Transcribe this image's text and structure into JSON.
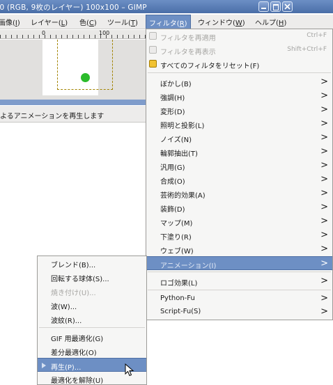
{
  "window": {
    "title": ".0 (RGB, 9枚のレイヤー) 100x100 – GIMP"
  },
  "menubar": {
    "items": [
      {
        "label": "画像(",
        "key": "I",
        "tail": ")"
      },
      {
        "label": "レイヤー(",
        "key": "L",
        "tail": ")"
      },
      {
        "label": "色(",
        "key": "C",
        "tail": ")"
      },
      {
        "label": "ツール(",
        "key": "T",
        "tail": ")"
      },
      {
        "label": "フィルタ(",
        "key": "R",
        "tail": ")"
      },
      {
        "label": "ウィンドウ(",
        "key": "W",
        "tail": ")"
      },
      {
        "label": "ヘルプ(",
        "key": "H",
        "tail": ")"
      }
    ]
  },
  "ruler": {
    "label_a": "0",
    "label_b": "100"
  },
  "status": {
    "text": "よるアニメーションを再生します"
  },
  "filters_menu": {
    "top": [
      {
        "label": "フィルタを再適用",
        "accel": "Ctrl+F",
        "disabled": true
      },
      {
        "label": "フィルタを再表示",
        "accel": "Shift+Ctrl+F",
        "disabled": true
      },
      {
        "label": "すべてのフィルタをリセット(F)",
        "disabled": false
      }
    ],
    "groups": [
      "ぼかし(B)",
      "強調(H)",
      "変形(D)",
      "照明と投影(L)",
      "ノイズ(N)",
      "輪郭抽出(T)",
      "汎用(G)",
      "合成(O)",
      "芸術的効果(A)",
      "装飾(D)",
      "マップ(M)",
      "下塗り(R)",
      "ウェブ(W)",
      "アニメーション(I)"
    ],
    "logo": "ロゴ効果(L)",
    "scripts": [
      "Python-Fu",
      "Script-Fu(S)"
    ]
  },
  "animation_menu": {
    "items": [
      {
        "label": "ブレンド(B)...",
        "disabled": false
      },
      {
        "label": "回転する球体(S)...",
        "disabled": false
      },
      {
        "label": "焼き付け(U)...",
        "disabled": true
      },
      {
        "label": "波(W)...",
        "disabled": false
      },
      {
        "label": "波紋(R)...",
        "disabled": false
      }
    ],
    "items2": [
      {
        "label": "GIF 用最適化(G)"
      },
      {
        "label": "差分最適化(O)"
      },
      {
        "label": "再生(P)..."
      },
      {
        "label": "最適化を解除(U)"
      }
    ]
  },
  "colors": {
    "accent": "#6d8fc4",
    "dot": "#2bbb2b"
  },
  "icons": {
    "cursor": "arrow-cursor-icon",
    "reset": "reset-icon"
  }
}
